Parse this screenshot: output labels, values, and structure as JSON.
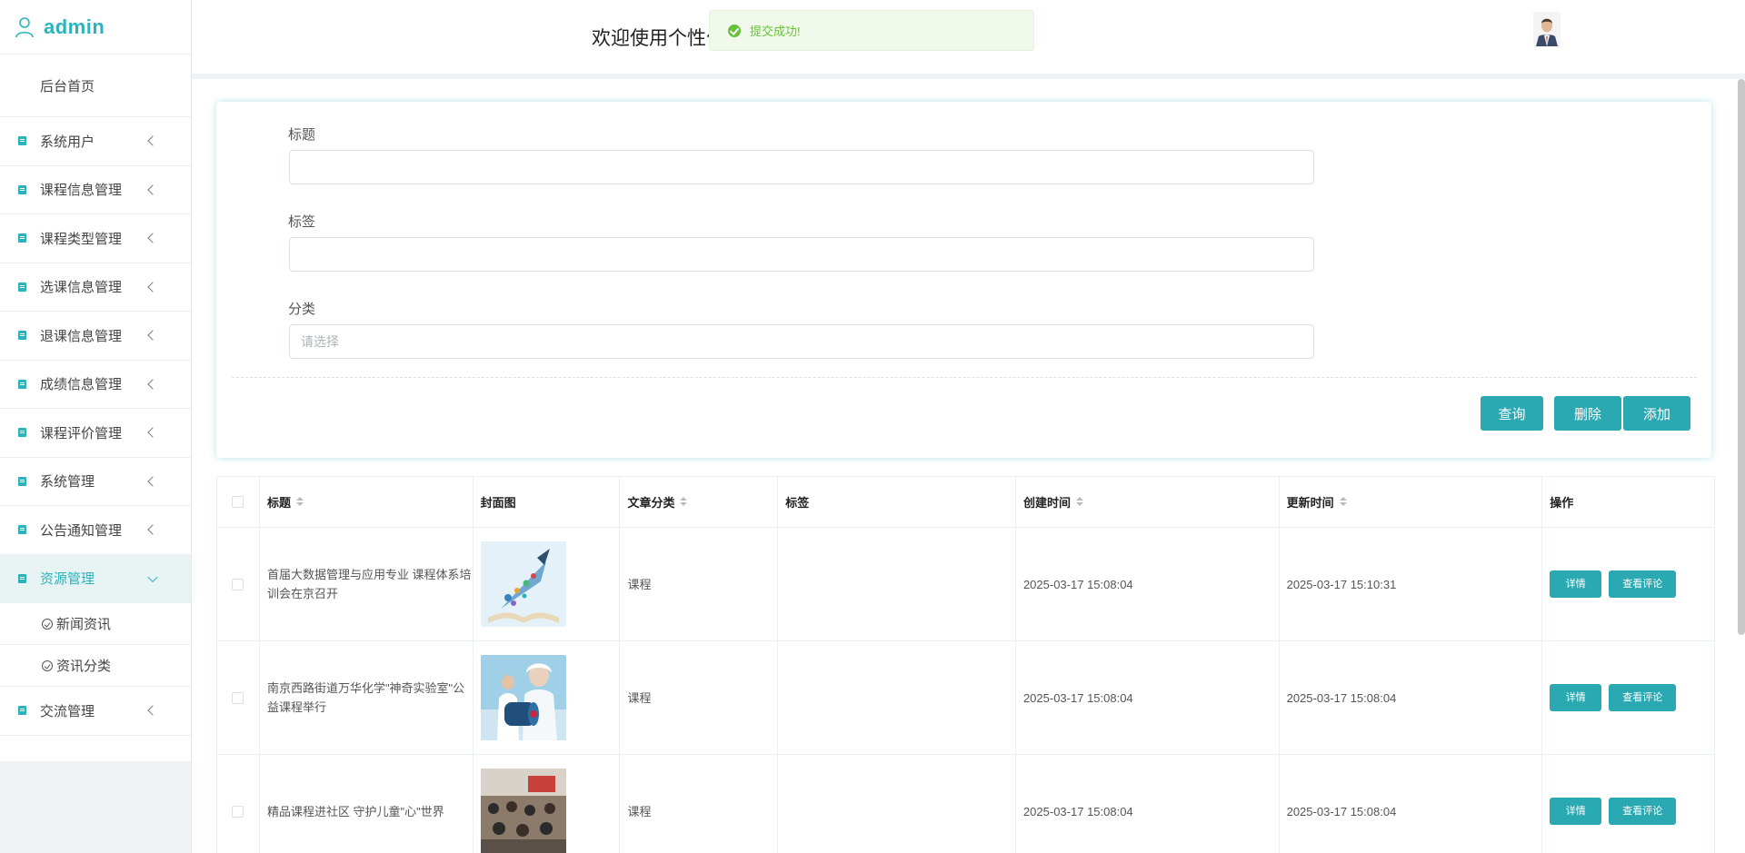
{
  "brand": {
    "name": "admin"
  },
  "sidebar": {
    "home": "后台首页",
    "items": [
      {
        "label": "系统用户"
      },
      {
        "label": "课程信息管理"
      },
      {
        "label": "课程类型管理"
      },
      {
        "label": "选课信息管理"
      },
      {
        "label": "退课信息管理"
      },
      {
        "label": "成绩信息管理"
      },
      {
        "label": "课程评价管理"
      },
      {
        "label": "系统管理"
      },
      {
        "label": "公告通知管理"
      },
      {
        "label": "资源管理"
      }
    ],
    "subitems": [
      {
        "label": "新闻资讯"
      },
      {
        "label": "资讯分类"
      }
    ],
    "last": {
      "label": "交流管理"
    }
  },
  "header": {
    "title": "欢迎使用个性化"
  },
  "toast": {
    "text": "提交成功!"
  },
  "search": {
    "title_label": "标题",
    "tags_label": "标签",
    "category_label": "分类",
    "category_placeholder": "请选择",
    "query_button": "查询",
    "delete_button": "删除",
    "add_button": "添加"
  },
  "table": {
    "headers": [
      "标题",
      "封面图",
      "文章分类",
      "标签",
      "创建时间",
      "更新时间",
      "操作"
    ],
    "rows": [
      {
        "title": "首届大数据管理与应用专业 课程体系培训会在京召开",
        "category": "课程",
        "tags": "",
        "created": "2025-03-17 15:08:04",
        "updated": "2025-03-17 15:10:31"
      },
      {
        "title": "南京西路街道万华化学\"神奇实验室\"公益课程举行",
        "category": "课程",
        "tags": "",
        "created": "2025-03-17 15:08:04",
        "updated": "2025-03-17 15:08:04"
      },
      {
        "title": "精品课程进社区 守护儿童\"心\"世界",
        "category": "课程",
        "tags": "",
        "created": "2025-03-17 15:08:04",
        "updated": "2025-03-17 15:08:04"
      }
    ],
    "detail_button": "详情",
    "comments_button": "查看评论"
  },
  "colors": {
    "accent": "#2ba9b3",
    "success": "#67c23a"
  }
}
